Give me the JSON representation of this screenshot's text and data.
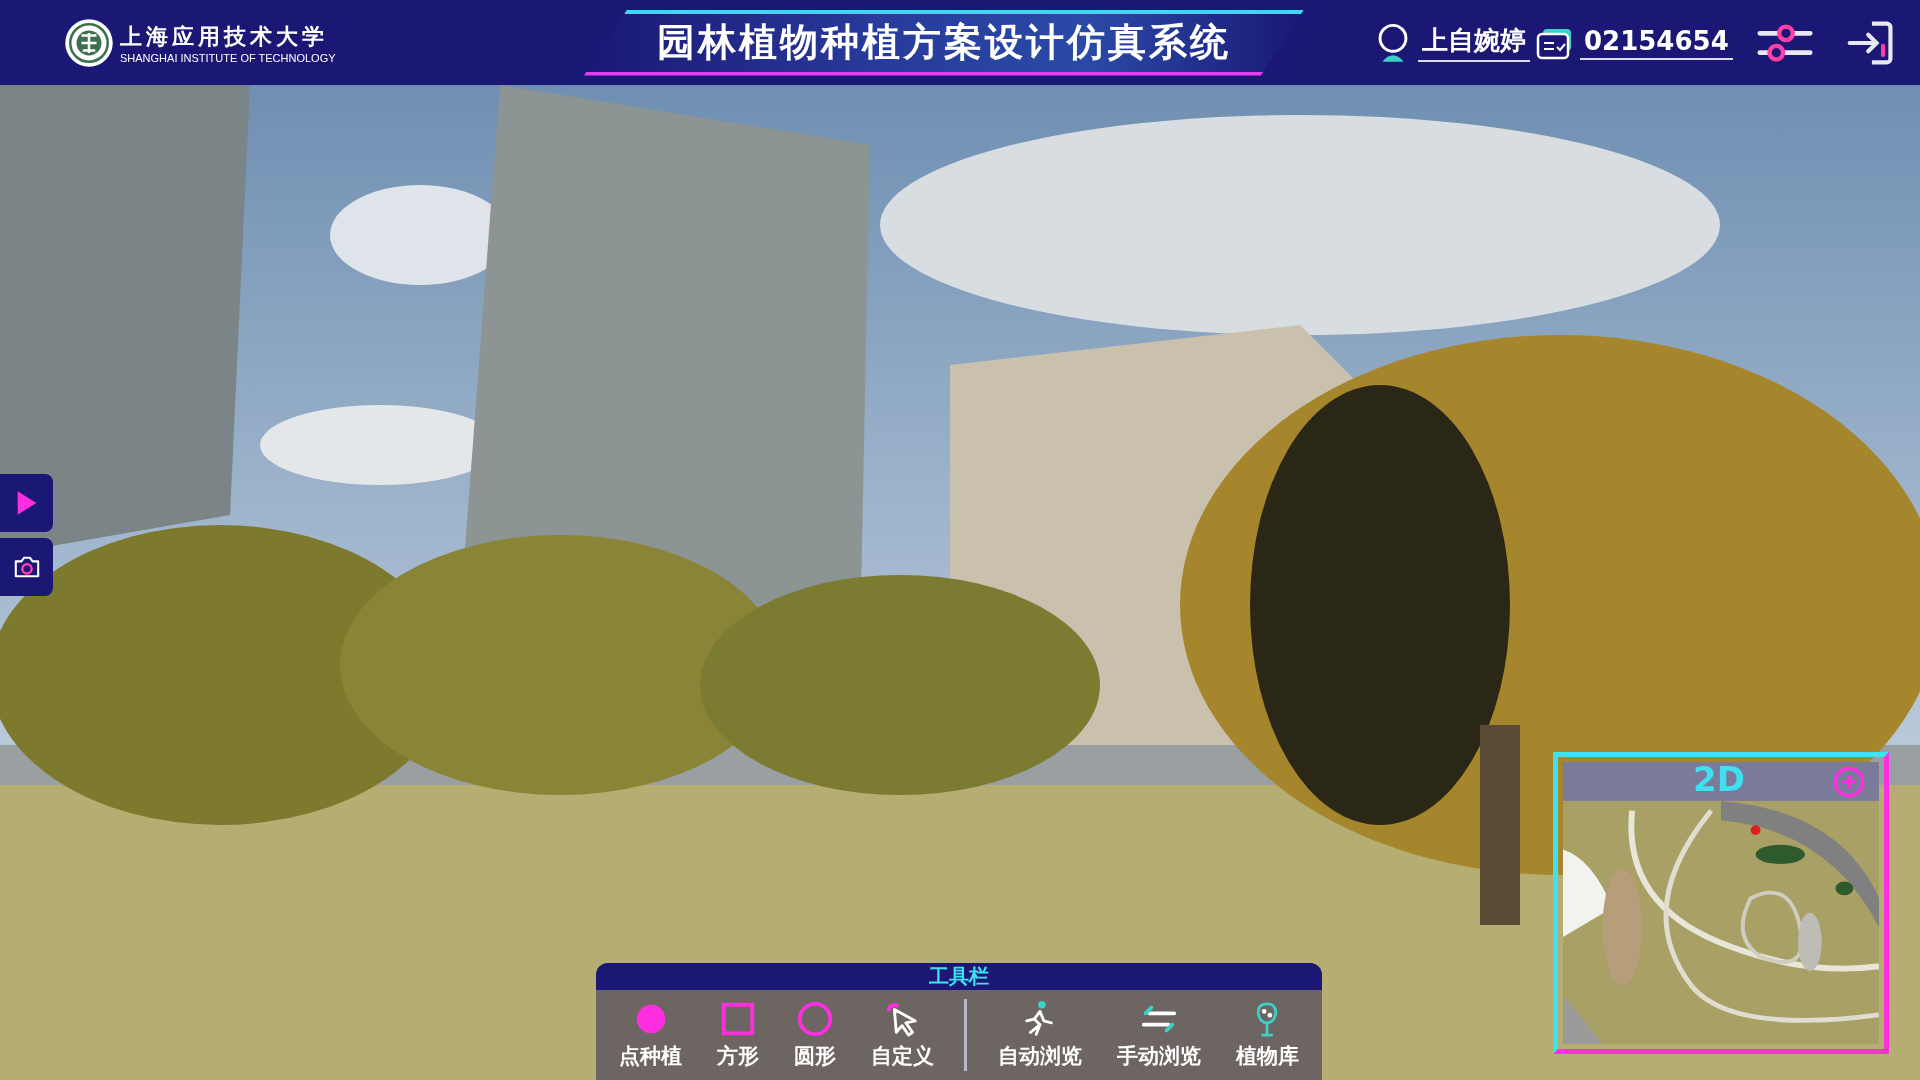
{
  "header": {
    "school_name": "上海应用技术大学",
    "school_subtitle": "SHANGHAI INSTITUTE OF TECHNOLOGY",
    "title": "园林植物种植方案设计仿真系统",
    "user_name": "上自婉婷",
    "user_id": "02154654"
  },
  "toolbar": {
    "title": "工具栏",
    "groups": [
      [
        {
          "label": "点种植",
          "kind": "dot"
        },
        {
          "label": "方形",
          "kind": "square"
        },
        {
          "label": "圆形",
          "kind": "circle"
        },
        {
          "label": "自定义",
          "kind": "custom"
        }
      ],
      [
        {
          "label": "自动浏览",
          "kind": "auto"
        },
        {
          "label": "手动浏览",
          "kind": "manual"
        },
        {
          "label": "植物库",
          "kind": "library"
        }
      ]
    ]
  },
  "minimap": {
    "mode_label": "2D"
  }
}
